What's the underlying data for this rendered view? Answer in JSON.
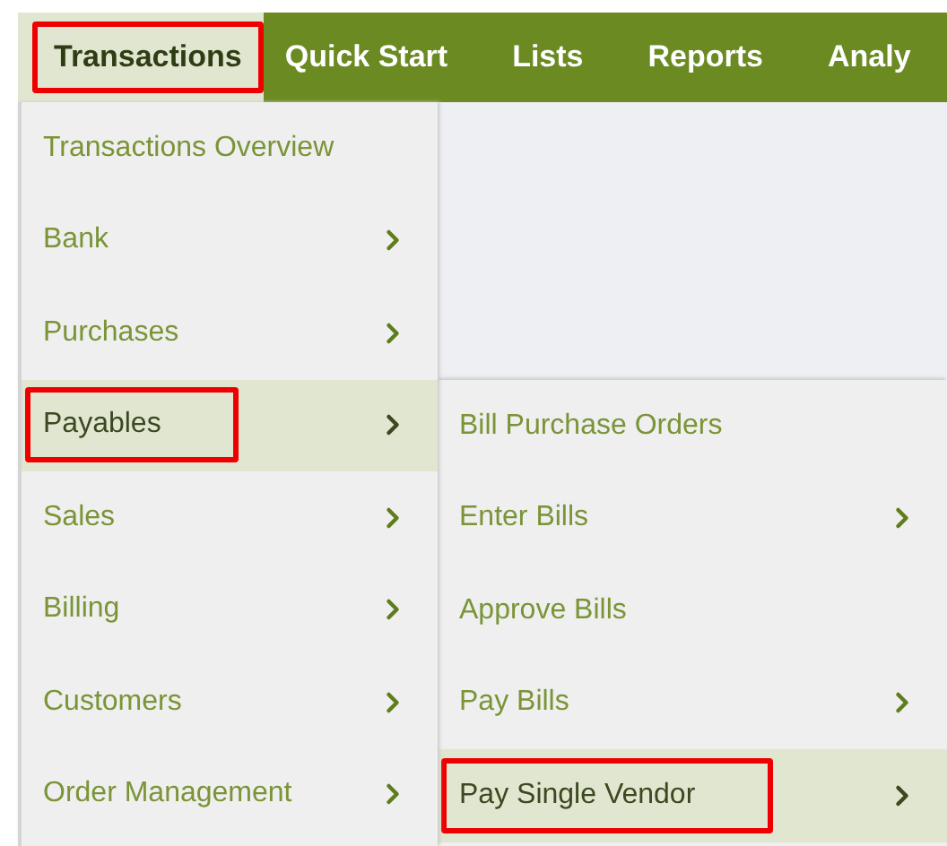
{
  "nav": {
    "items": [
      {
        "label": "Transactions",
        "selected": true,
        "outlined": true
      },
      {
        "label": "Quick Start",
        "selected": false,
        "outlined": false
      },
      {
        "label": "Lists",
        "selected": false,
        "outlined": false
      },
      {
        "label": "Reports",
        "selected": false,
        "outlined": false
      },
      {
        "label": "Analy",
        "selected": false,
        "outlined": false
      }
    ]
  },
  "menu": {
    "items": [
      {
        "label": "Transactions Overview",
        "has_submenu": false,
        "selected": false,
        "outlined": false
      },
      {
        "label": "Bank",
        "has_submenu": true,
        "selected": false,
        "outlined": false
      },
      {
        "label": "Purchases",
        "has_submenu": true,
        "selected": false,
        "outlined": false
      },
      {
        "label": "Payables",
        "has_submenu": true,
        "selected": true,
        "outlined": true
      },
      {
        "label": "Sales",
        "has_submenu": true,
        "selected": false,
        "outlined": false
      },
      {
        "label": "Billing",
        "has_submenu": true,
        "selected": false,
        "outlined": false
      },
      {
        "label": "Customers",
        "has_submenu": true,
        "selected": false,
        "outlined": false
      },
      {
        "label": "Order Management",
        "has_submenu": true,
        "selected": false,
        "outlined": false
      }
    ]
  },
  "submenu": {
    "items": [
      {
        "label": "Bill Purchase Orders",
        "has_submenu": false,
        "selected": false,
        "outlined": false
      },
      {
        "label": "Enter Bills",
        "has_submenu": true,
        "selected": false,
        "outlined": false
      },
      {
        "label": "Approve Bills",
        "has_submenu": false,
        "selected": false,
        "outlined": false
      },
      {
        "label": "Pay Bills",
        "has_submenu": true,
        "selected": false,
        "outlined": false
      },
      {
        "label": "Pay Single Vendor",
        "has_submenu": true,
        "selected": true,
        "outlined": true
      }
    ]
  }
}
